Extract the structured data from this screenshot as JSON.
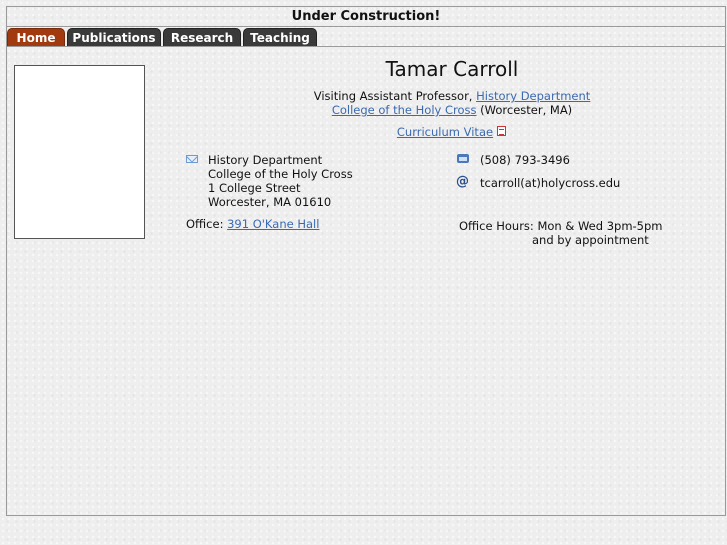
{
  "banner": {
    "text": "Under Construction!"
  },
  "tabs": [
    {
      "label": "Home",
      "active": true
    },
    {
      "label": "Publications",
      "active": false
    },
    {
      "label": "Research",
      "active": false
    },
    {
      "label": "Teaching",
      "active": false
    }
  ],
  "profile": {
    "name": "Tamar Carroll",
    "title_prefix": "Visiting Assistant Professor, ",
    "department_link": "History Department",
    "college_link": "College of the Holy Cross",
    "location": " (Worcester, MA)",
    "cv_link": "Curriculum Vitae"
  },
  "address": {
    "lines": [
      "History Department",
      "College of the Holy Cross",
      "1 College Street",
      "Worcester, MA 01610"
    ]
  },
  "office": {
    "label": "Office: ",
    "room_link": "391 O'Kane Hall"
  },
  "contact": {
    "phone": "(508) 793-3496",
    "email": "tcarroll(at)holycross.edu"
  },
  "hours": {
    "line1": "Office Hours: Mon & Wed 3pm-5pm",
    "line2": "and by appointment"
  },
  "colors": {
    "active_tab": "#a23a10",
    "tab": "#3a3a3a",
    "link": "#3a6ab0"
  }
}
